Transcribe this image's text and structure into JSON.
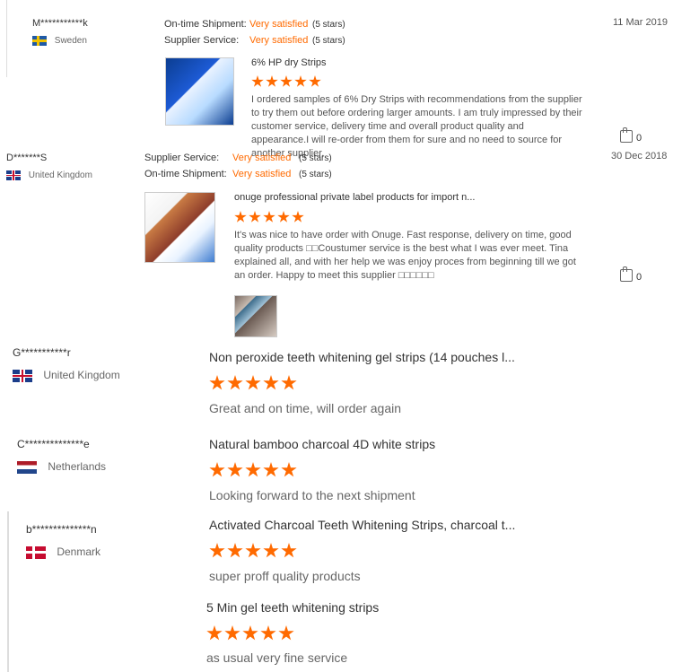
{
  "reviews": [
    {
      "user": "M***********k",
      "country": "Sweden",
      "date": "11 Mar 2019",
      "labels": {
        "shipment": "On-time Shipment:",
        "service": "Supplier Service:"
      },
      "shipment_value": "Very satisfied",
      "service_value": "Very satisfied",
      "stars_text": "(5 stars)",
      "product_title": "6% HP dry Strips",
      "rating": 5,
      "text": "I ordered samples of 6% Dry Strips with recommendations from the supplier to try them out before ordering larger amounts. I am truly impressed by their customer service, delivery time and overall product quality and appearance.I will re-order from them for sure and no need to source for another supplier.",
      "likes": "0"
    },
    {
      "user": "D*******S",
      "country": "United Kingdom",
      "date": "30 Dec 2018",
      "labels": {
        "service": "Supplier Service:",
        "shipment": "On-time Shipment:"
      },
      "service_value": "Very satisfied",
      "shipment_value": "Very satisfied",
      "stars_text": "(5 stars)",
      "product_title": "onuge professional private label products for import n...",
      "rating": 5,
      "text": "It's was nice to have order with Onuge. Fast response, delivery on time, good quality products □□Coustumer service is the best what I was ever meet. Tina explained all, and with her help we was enjoy proces from beginning till we got an order. Happy to meet this supplier □□□□□□",
      "likes": "0"
    },
    {
      "user": "G***********r",
      "country": "United Kingdom",
      "product_title": "Non peroxide teeth whitening gel strips (14 pouches l...",
      "rating": 5,
      "text": "Great and on time, will order again"
    },
    {
      "user": "C**************e",
      "country": "Netherlands",
      "product_title": "Natural bamboo charcoal 4D white strips",
      "rating": 5,
      "text": "Looking forward to the next shipment"
    },
    {
      "user": "b**************n",
      "country": "Denmark",
      "items": [
        {
          "product_title": "Activated Charcoal Teeth Whitening Strips, charcoal t...",
          "rating": 5,
          "text": "super proff quality products"
        },
        {
          "product_title": "5 Min gel teeth whitening strips",
          "rating": 5,
          "text": "as usual very fine service"
        }
      ]
    }
  ],
  "icons": {
    "like": "thumb-up-icon",
    "star": "star-icon"
  },
  "colors": {
    "accent": "#ff6a00",
    "text": "#333333",
    "muted": "#666666"
  }
}
